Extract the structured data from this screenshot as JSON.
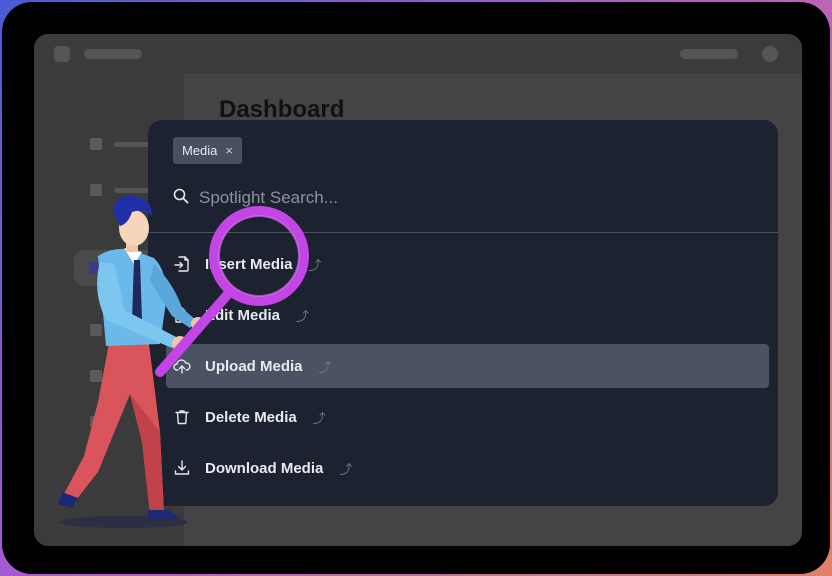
{
  "background_app": {
    "title": "Dashboard"
  },
  "spotlight": {
    "chip_label": "Media",
    "chip_close_glyph": "×",
    "search_placeholder": "Spotlight Search...",
    "items": [
      {
        "label": "Insert Media",
        "icon": "file-import-icon",
        "hint": "⤴",
        "selected": false
      },
      {
        "label": "Edit Media",
        "icon": "file-edit-icon",
        "hint": "⤴",
        "selected": false
      },
      {
        "label": "Upload Media",
        "icon": "cloud-upload-icon",
        "hint": "⤴",
        "selected": true
      },
      {
        "label": "Delete Media",
        "icon": "trash-icon",
        "hint": "⤴",
        "selected": false
      },
      {
        "label": "Download Media",
        "icon": "download-icon",
        "hint": "⤴",
        "selected": false
      }
    ]
  },
  "colors": {
    "panel_bg": "#1d2230",
    "selected_bg": "#4a5263",
    "chip_bg": "#48505f",
    "magnifier": "#c445e6"
  }
}
